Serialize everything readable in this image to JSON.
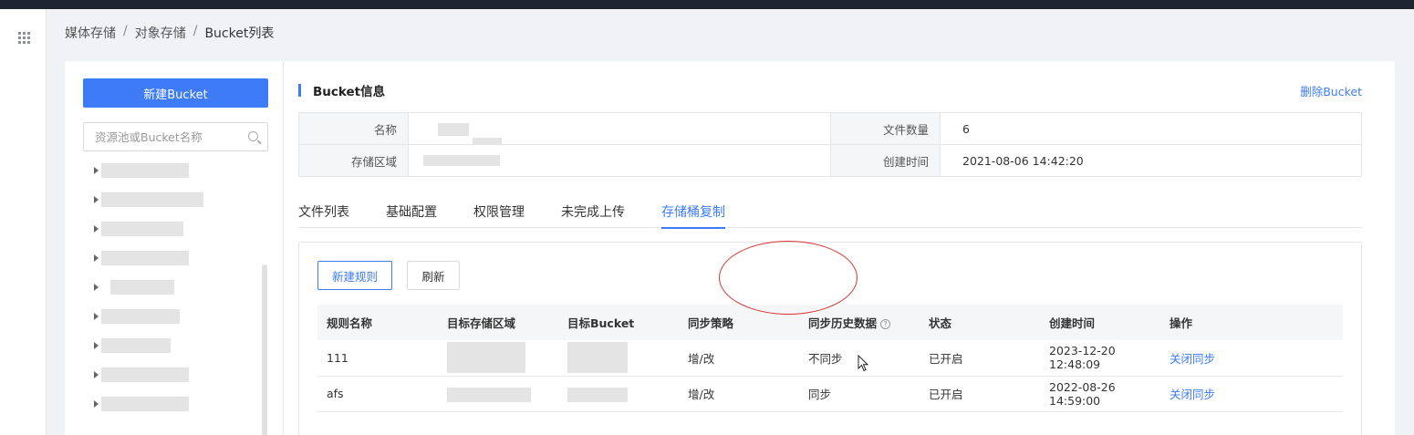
{
  "breadcrumb": [
    "媒体存储",
    "对象存储",
    "Bucket列表"
  ],
  "sidebar": {
    "new_bucket_label": "新建Bucket",
    "search_placeholder": "资源池或Bucket名称",
    "tree_item_count_visible": 9
  },
  "bucket_info": {
    "title": "Bucket信息",
    "delete_label": "删除Bucket",
    "fields": {
      "name_label": "名称",
      "name_value": "",
      "region_label": "存储区域",
      "region_value": "",
      "file_count_label": "文件数量",
      "file_count_value": "6",
      "created_label": "创建时间",
      "created_value": "2021-08-06 14:42:20"
    }
  },
  "tabs": [
    {
      "label": "文件列表",
      "active": false
    },
    {
      "label": "基础配置",
      "active": false
    },
    {
      "label": "权限管理",
      "active": false
    },
    {
      "label": "未完成上传",
      "active": false
    },
    {
      "label": "存储桶复制",
      "active": true
    }
  ],
  "replication": {
    "new_rule_label": "新建规则",
    "refresh_label": "刷新",
    "columns": [
      "规则名称",
      "目标存储区域",
      "目标Bucket",
      "同步策略",
      "同步历史数据",
      "状态",
      "创建时间",
      "操作"
    ],
    "rows": [
      {
        "name": "111",
        "target_region": "",
        "target_bucket": "",
        "policy": "增/改",
        "sync_history": "不同步",
        "status": "已开启",
        "created": "2023-12-20 12:48:09",
        "action": "关闭同步"
      },
      {
        "name": "afs",
        "target_region": "",
        "target_bucket": "",
        "policy": "增/改",
        "sync_history": "同步",
        "status": "已开启",
        "created": "2022-08-26 14:59:00",
        "action": "关闭同步"
      }
    ]
  },
  "colors": {
    "accent": "#3d7bf7",
    "annotation": "#d9302c"
  }
}
